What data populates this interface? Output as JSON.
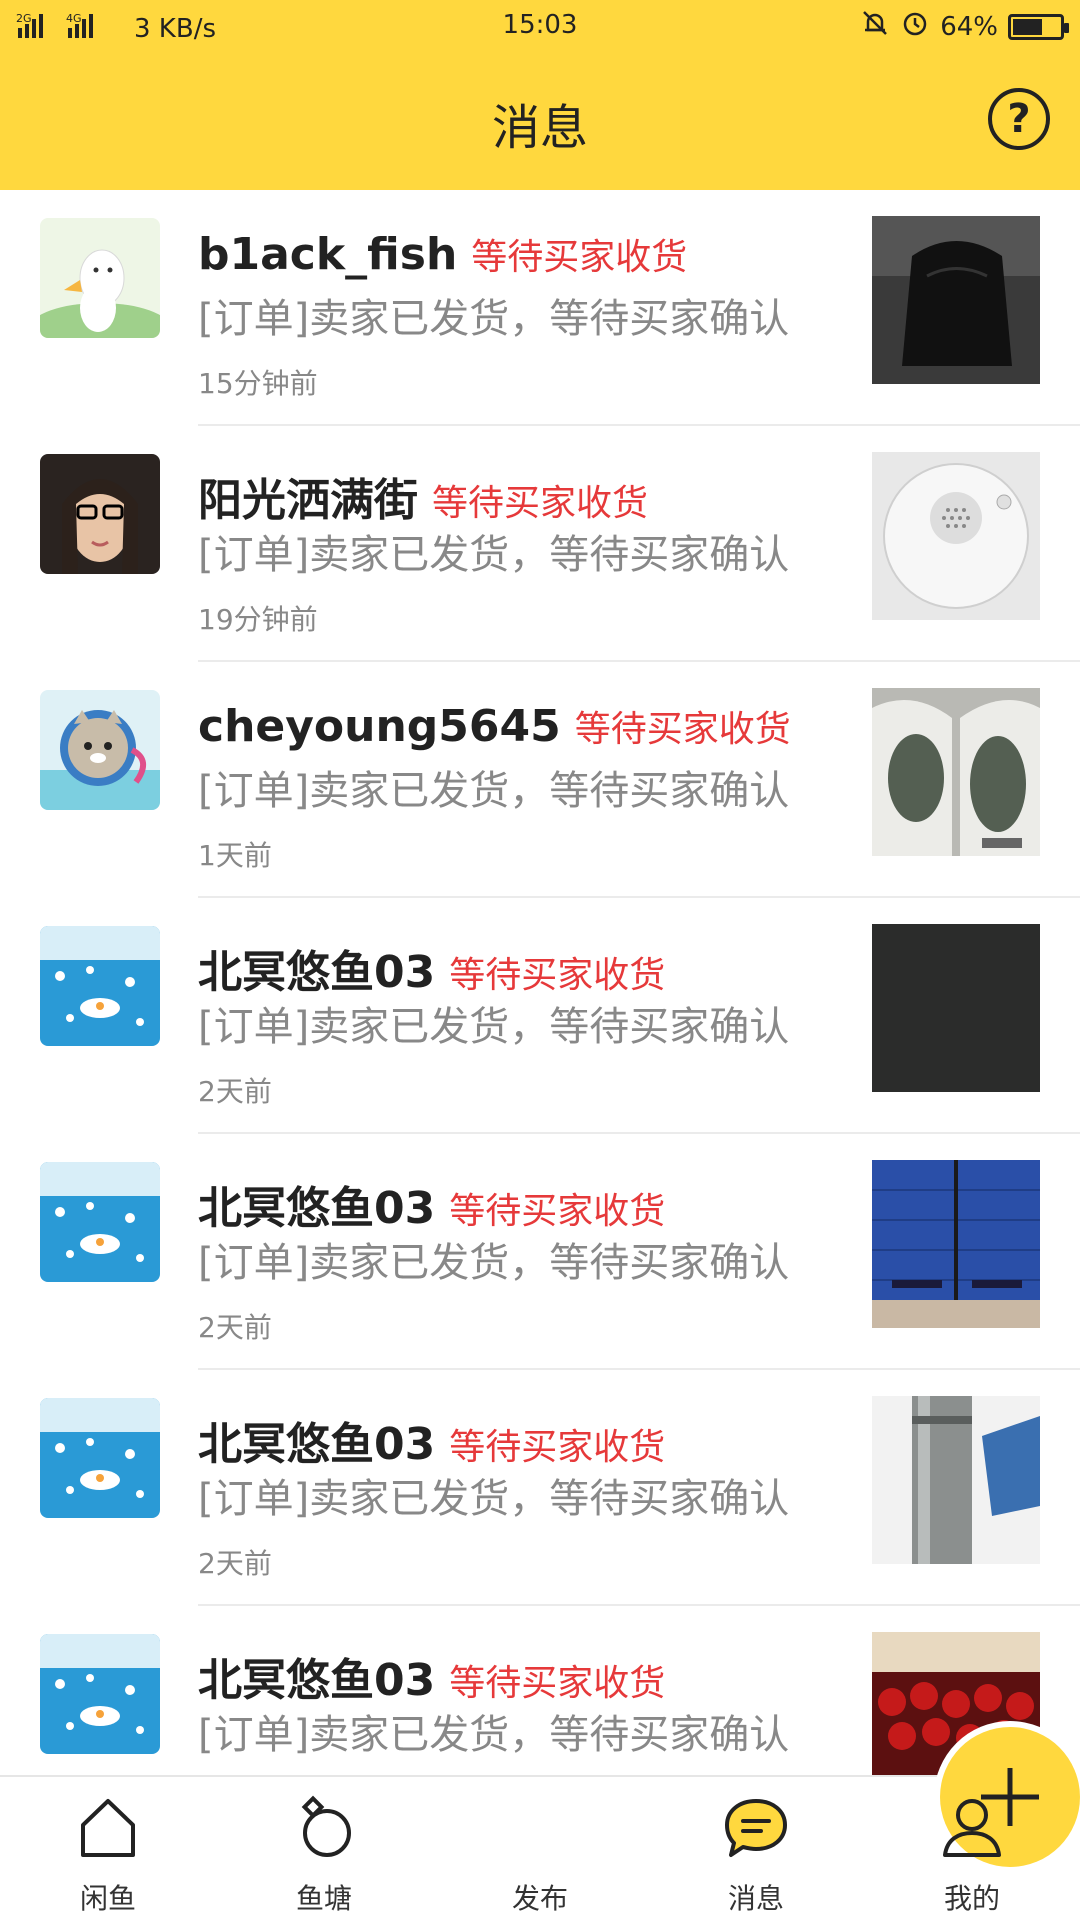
{
  "status_bar": {
    "network": "2G 4G",
    "speed": "3 KB/s",
    "time": "15:03",
    "battery": "64%",
    "battery_level": 0.64
  },
  "header": {
    "title": "消息",
    "help_label": "?"
  },
  "messages": [
    {
      "username": "b1ack_fish",
      "status": "等待买家收货",
      "snippet": "[订单]卖家已发货，等待买家确认",
      "time": "15分钟前"
    },
    {
      "username": "阳光洒满街",
      "status": "等待买家收货",
      "snippet": "[订单]卖家已发货，等待买家确认",
      "time": "19分钟前"
    },
    {
      "username": "cheyoung5645",
      "status": "等待买家收货",
      "snippet": "[订单]卖家已发货，等待买家确认",
      "time": "1天前"
    },
    {
      "username": "北冥悠鱼03",
      "status": "等待买家收货",
      "snippet": "[订单]卖家已发货，等待买家确认",
      "time": "2天前"
    },
    {
      "username": "北冥悠鱼03",
      "status": "等待买家收货",
      "snippet": "[订单]卖家已发货，等待买家确认",
      "time": "2天前"
    },
    {
      "username": "北冥悠鱼03",
      "status": "等待买家收货",
      "snippet": "[订单]卖家已发货，等待买家确认",
      "time": "2天前"
    },
    {
      "username": "北冥悠鱼03",
      "status": "等待买家收货",
      "snippet": "[订单]卖家已发货，等待买家确认",
      "time": ""
    }
  ],
  "tabs": {
    "home": "闲鱼",
    "pond": "鱼塘",
    "publish": "发布",
    "messages": "消息",
    "mine": "我的"
  },
  "colors": {
    "accent": "#ffd83e",
    "status_red": "#e6393a"
  }
}
